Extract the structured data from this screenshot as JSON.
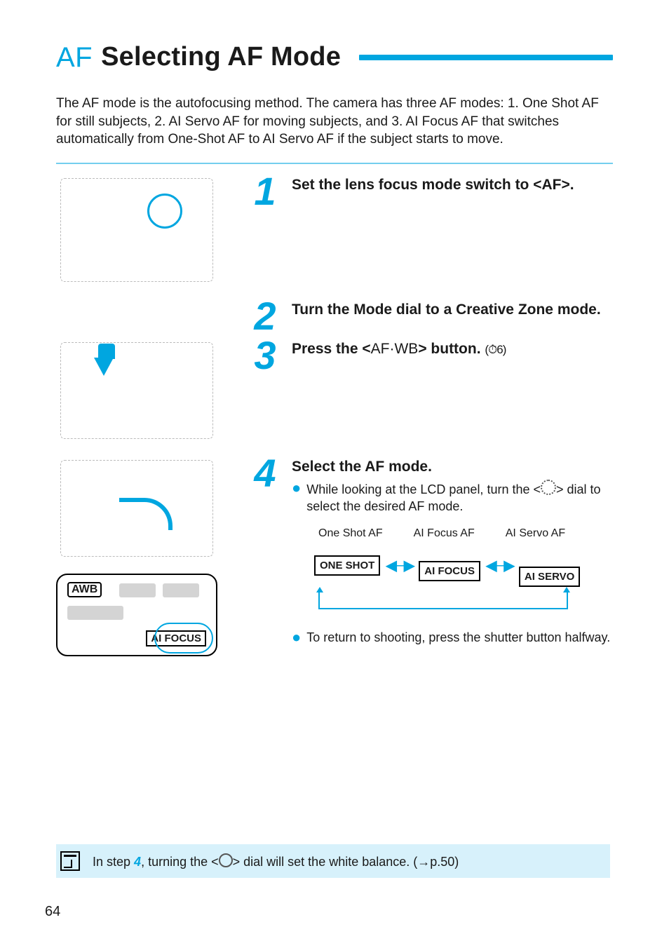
{
  "title": {
    "prefix": "AF",
    "main": "Selecting AF Mode"
  },
  "intro": "The AF mode is the autofocusing method. The camera has three AF modes: 1. One Shot AF for still subjects, 2. AI Servo AF for moving subjects, and 3. AI Focus AF that switches automatically from One-Shot AF to AI Servo AF if the subject starts to move.",
  "steps": {
    "s1": {
      "num": "1",
      "heading": "Set the lens focus mode switch to <AF>."
    },
    "s2": {
      "num": "2",
      "heading": "Turn the Mode dial to a Creative Zone mode."
    },
    "s3": {
      "num": "3",
      "heading_pre": "Press the <",
      "heading_btn": "AF·WB",
      "heading_post": "> button.",
      "timer": "(⏱6)"
    },
    "s4": {
      "num": "4",
      "heading": "Select the AF mode.",
      "bullet1_pre": "While looking at the LCD panel, turn the <",
      "bullet1_post": "> dial to select the desired AF mode.",
      "diagram": {
        "labels": {
          "one": "One Shot AF",
          "focus": "AI Focus AF",
          "servo": "AI Servo AF"
        },
        "boxes": {
          "one": "ONE SHOT",
          "focus": "AI FOCUS",
          "servo": "AI SERVO"
        }
      },
      "bullet2": "To return to shooting, press the shutter button halfway."
    }
  },
  "lcd": {
    "awb": "AWB",
    "aifocus": "AI FOCUS"
  },
  "note": {
    "pre": "In step ",
    "step": "4",
    "mid": ", turning the <",
    "post": "> dial will set the white balance. (→p.50)"
  },
  "page_number": "64"
}
